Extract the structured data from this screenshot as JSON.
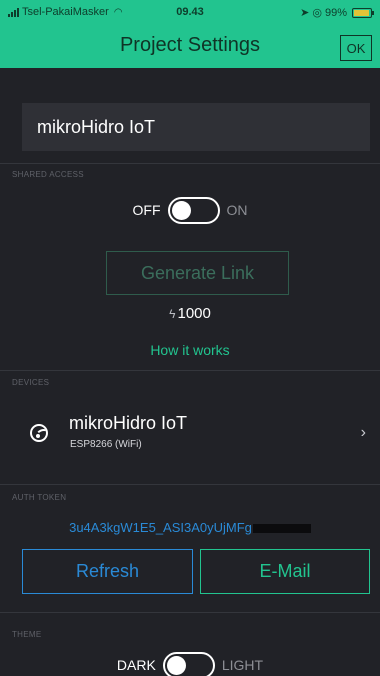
{
  "status_bar": {
    "carrier": "Tsel-PakaiMasker",
    "time": "09.43",
    "battery": "99%",
    "signal_icon": "signal-bars-icon",
    "wifi_icon": "wifi-icon",
    "location_icon": "location-arrow-icon",
    "alarm_icon": "alarm-icon",
    "battery_icon": "battery-charging-icon"
  },
  "header": {
    "title": "Project Settings",
    "ok_label": "OK"
  },
  "project": {
    "name": "mikroHidro IoT"
  },
  "shared_access": {
    "section_label": "SHARED ACCESS",
    "toggle_off_label": "OFF",
    "toggle_on_label": "ON",
    "toggle_state": "off",
    "generate_link_label": "Generate Link",
    "energy_value": "1000",
    "energy_icon": "bolt-icon",
    "how_it_works_label": "How it works"
  },
  "devices": {
    "section_label": "DEVICES",
    "items": [
      {
        "name": "mikroHidro IoT",
        "type": "ESP8266 (WiFi)",
        "icon": "espressif-icon"
      }
    ]
  },
  "auth_token": {
    "section_label": "AUTH TOKEN",
    "token_visible": "3u4A3kgW1E5_ASI3A0yUjMFg",
    "refresh_label": "Refresh",
    "email_label": "E-Mail"
  },
  "theme": {
    "section_label": "THEME",
    "dark_label": "DARK",
    "light_label": "LIGHT",
    "toggle_state": "dark"
  },
  "colors": {
    "header_green": "#22c48f",
    "background": "#212227",
    "accent_blue": "#2a8ad6",
    "accent_green": "#22c48f"
  }
}
